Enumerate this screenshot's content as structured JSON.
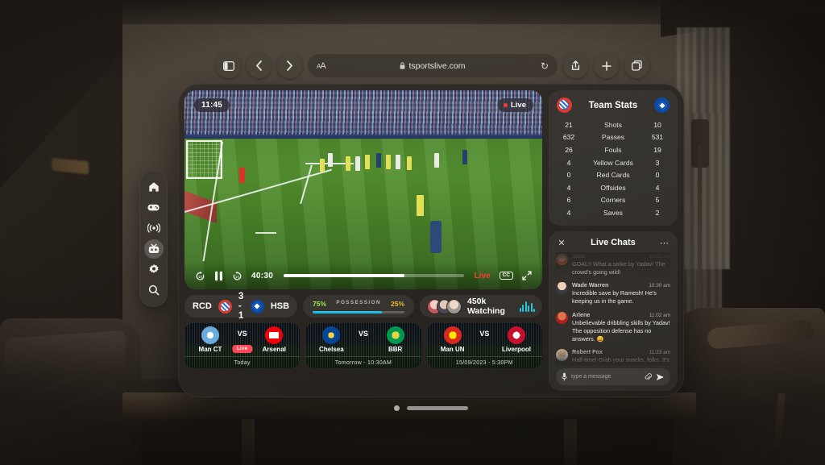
{
  "browser": {
    "url": "tsportslive.com",
    "lock_icon": "lock-icon",
    "text_size_label": "aA",
    "sidebar_toggle": "sidebar-toggle",
    "back": "‹",
    "forward": "›",
    "reload": "↻",
    "share": "share-icon",
    "new_tab": "+",
    "tabs": "tabs-icon"
  },
  "sidebar": {
    "items": [
      {
        "icon": "home-icon",
        "label": "Home",
        "active": false
      },
      {
        "icon": "gamepad-icon",
        "label": "Games",
        "active": false
      },
      {
        "icon": "broadcast-icon",
        "label": "Live",
        "active": false
      },
      {
        "icon": "tv-icon",
        "label": "TV",
        "active": true
      },
      {
        "icon": "gear-icon",
        "label": "Settings",
        "active": false
      },
      {
        "icon": "search-icon",
        "label": "Search",
        "active": false
      }
    ]
  },
  "player": {
    "clock_badge": "11:45",
    "live_badge": "Live",
    "current_time": "40:30",
    "progress_percent": 67,
    "live_label": "Live",
    "cc_label": "CC",
    "controls": {
      "rewind": "rewind-10-icon",
      "pause": "pause-icon",
      "forward": "forward-10-icon",
      "fullscreen": "fullscreen-icon"
    }
  },
  "scorebar": {
    "home_abbr": "RCD",
    "away_abbr": "HSB",
    "score": "3 - 1",
    "home_crest": "rcd-espanyol-crest",
    "away_crest": "hsb-hamburg-crest"
  },
  "possession": {
    "label": "POSSESSION",
    "home_pct": "75%",
    "away_pct": "25%",
    "home_value": 75,
    "away_value": 25,
    "home_color": "#9ee84a",
    "away_color": "#e8b93a",
    "bar_color": "#1fc0e8"
  },
  "watching": {
    "count_label": "450k Watching",
    "waveform_icon": "audio-waveform-icon",
    "waveform_color": "#25c7e0",
    "avatar_count": 3
  },
  "match_cards": [
    {
      "home": "Man CT",
      "away": "Arsenal",
      "vs": "VS",
      "status": "Live",
      "footer": "Today",
      "is_live": true,
      "home_logo": "man-city-logo",
      "away_logo": "arsenal-logo"
    },
    {
      "home": "Chelsea",
      "away": "BBR",
      "vs": "VS",
      "status": "",
      "footer": "Tomorrow  -  10:30AM",
      "is_live": false,
      "home_logo": "chelsea-logo",
      "away_logo": "blackburn-logo"
    },
    {
      "home": "Man UN",
      "away": "Liverpool",
      "vs": "VS",
      "status": "",
      "footer": "15/09/2023  -  5:30PM",
      "is_live": false,
      "home_logo": "man-united-logo",
      "away_logo": "liverpool-logo"
    }
  ],
  "team_stats": {
    "title": "Team Stats",
    "home_crest": "rcd-espanyol-crest",
    "away_crest": "hsb-hamburg-crest",
    "rows": [
      {
        "home": "21",
        "name": "Shots",
        "away": "10"
      },
      {
        "home": "632",
        "name": "Passes",
        "away": "531"
      },
      {
        "home": "26",
        "name": "Fouls",
        "away": "19"
      },
      {
        "home": "4",
        "name": "Yellow Cards",
        "away": "3"
      },
      {
        "home": "0",
        "name": "Red Cards",
        "away": "0"
      },
      {
        "home": "4",
        "name": "Offsides",
        "away": "4"
      },
      {
        "home": "6",
        "name": "Corners",
        "away": "5"
      },
      {
        "home": "4",
        "name": "Saves",
        "away": "2"
      }
    ]
  },
  "live_chats": {
    "title": "Live Chats",
    "close_icon": "close-icon",
    "more_icon": "more-options-icon",
    "messages": [
      {
        "name": "Jane",
        "time": "10:15 am",
        "text": "GOAL!! What a strike by Yadav! The crowd's going wild!",
        "avatar": "avatar-jane"
      },
      {
        "name": "Wade Warren",
        "time": "10:30 am",
        "text": "Incredible save by Ramesh! He's keeping us in the game.",
        "avatar": "avatar-wade-warren"
      },
      {
        "name": "Arlene",
        "time": "11:02 am",
        "text": "Unbelievable dribbling skills by Yadav! The opposition defense has no answers. 😄",
        "avatar": "avatar-arlene"
      },
      {
        "name": "Robert Fox",
        "time": "11:23 am",
        "text": "Half-time! Grab your snacks, folks. It's been an amazing first half!",
        "avatar": "avatar-robert-fox"
      }
    ],
    "input": {
      "placeholder": "type a message",
      "mic_icon": "mic-icon",
      "attach_icon": "paperclip-icon",
      "send_icon": "send-icon"
    }
  },
  "window_chrome": {
    "grabber": "window-resize-handle",
    "close_dot": "window-close-dot"
  }
}
